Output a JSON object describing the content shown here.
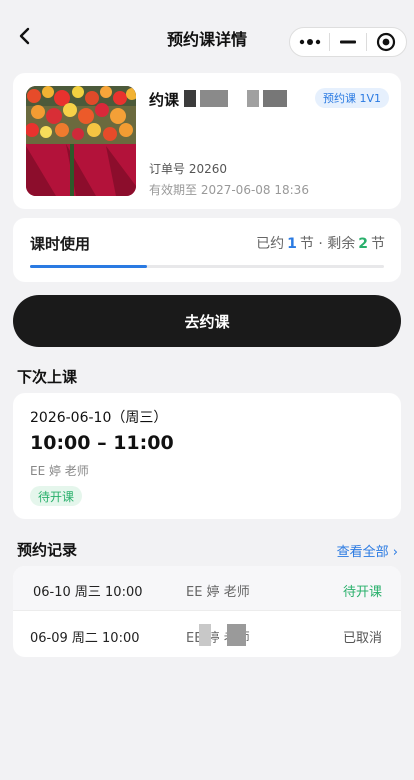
{
  "nav": {
    "title": "预约课详情",
    "back_icon": "chevron-left-icon",
    "more_icon": "more-dots-icon",
    "minimize_icon": "minimize-icon",
    "close_icon": "target-close-icon"
  },
  "order": {
    "course_name": "约课",
    "tag": "预约课 1V1",
    "order_no": "订单号 20260",
    "valid_until": "有效期至  2027-06-08 18:36"
  },
  "usage": {
    "title": "课时使用",
    "booked_prefix": "已约",
    "booked_count": "1",
    "booked_unit": "节 · 剩余",
    "remaining_count": "2",
    "remaining_unit": "节",
    "progress": 0.33
  },
  "book_button": "去约课",
  "next_class": {
    "section_title": "下次上课",
    "date": "2026-06-10（周三）",
    "time": "10:00 – 11:00",
    "teacher": "EE           婷 老师",
    "status": "待开课"
  },
  "records": {
    "section_title": "预约记录",
    "view_all": "查看全部 ›",
    "items": [
      {
        "date": "06-10 周三 10:00",
        "teacher": "EE          婷 老师",
        "status": "待开课",
        "status_color": "#2ab06c"
      },
      {
        "date": "06-09 周二 10:00",
        "teacher": "EE         婷 老师",
        "status": "已取消",
        "status_color": "#555555"
      }
    ]
  },
  "colors": {
    "accent_blue": "#2a7ae2",
    "accent_green": "#2ab06c",
    "button_dark": "#1a1a1a",
    "background": "#f2f2f4"
  }
}
